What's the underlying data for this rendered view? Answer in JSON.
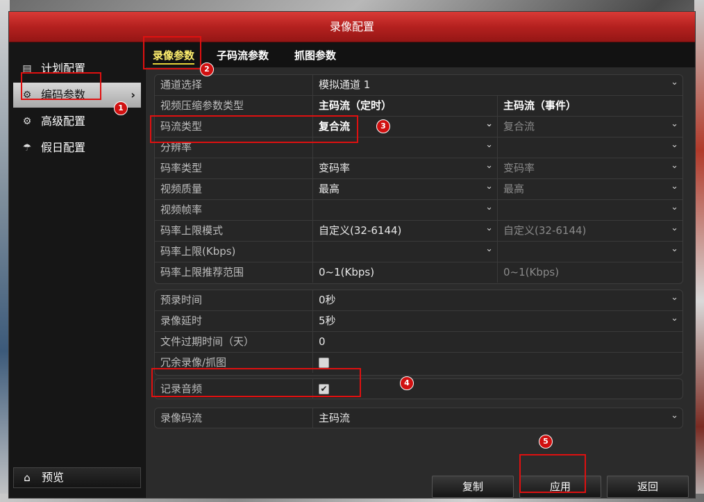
{
  "window": {
    "title": "录像配置"
  },
  "sidebar": {
    "items": [
      {
        "label": "计划配置",
        "icon": "calendar-icon"
      },
      {
        "label": "编码参数",
        "icon": "gear-sliders-icon"
      },
      {
        "label": "高级配置",
        "icon": "gears-icon"
      },
      {
        "label": "假日配置",
        "icon": "umbrella-icon"
      }
    ],
    "preview_label": "预览"
  },
  "tabs": [
    {
      "label": "录像参数"
    },
    {
      "label": "子码流参数"
    },
    {
      "label": "抓图参数"
    }
  ],
  "encode": {
    "channel_label": "通道选择",
    "channel_value": "模拟通道 1",
    "header_label": "视频压缩参数类型",
    "header_col1": "主码流（定时）",
    "header_col2": "主码流（事件）",
    "rows": [
      {
        "label": "码流类型",
        "v1": "复合流",
        "v2": "复合流"
      },
      {
        "label": "分辨率",
        "v1": "",
        "v2": ""
      },
      {
        "label": "码率类型",
        "v1": "变码率",
        "v2": "变码率"
      },
      {
        "label": "视频质量",
        "v1": "最高",
        "v2": "最高"
      },
      {
        "label": "视频帧率",
        "v1": "",
        "v2": ""
      },
      {
        "label": "码率上限模式",
        "v1": "自定义(32-6144)",
        "v2": "自定义(32-6144)"
      },
      {
        "label": "码率上限(Kbps)",
        "v1": "",
        "v2": ""
      },
      {
        "label": "码率上限推荐范围",
        "v1": "0~1(Kbps)",
        "v2": "0~1(Kbps)"
      }
    ]
  },
  "record": {
    "prerecord_label": "预录时间",
    "prerecord_value": "0秒",
    "delay_label": "录像延时",
    "delay_value": "5秒",
    "expire_label": "文件过期时间（天）",
    "expire_value": "0",
    "redundant_label": "冗余录像/抓图",
    "redundant_checked": false,
    "audio_label": "记录音频",
    "audio_checked": true,
    "audio_check_glyph": "✔",
    "stream_label": "录像码流",
    "stream_value": "主码流"
  },
  "buttons": {
    "copy": "复制",
    "apply": "应用",
    "back": "返回"
  },
  "annotations": [
    "1",
    "2",
    "3",
    "4",
    "5"
  ],
  "colors": {
    "title_red": "#b4211f",
    "annotation_red": "#e01010",
    "tab_active": "#ffef6e"
  }
}
